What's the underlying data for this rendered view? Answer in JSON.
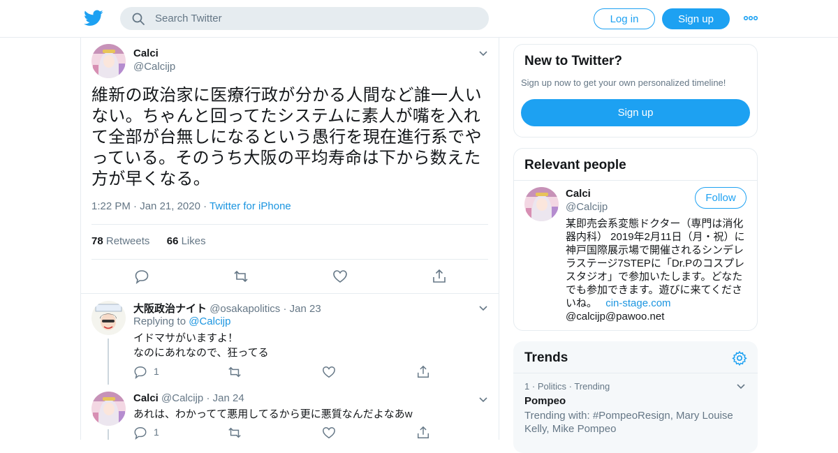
{
  "header": {
    "search_placeholder": "Search Twitter",
    "login_label": "Log in",
    "signup_label": "Sign up",
    "brand_color": "#1da1f2"
  },
  "tweet": {
    "author_name": "Calci",
    "author_handle": "@Calcijp",
    "text": "維新の政治家に医療行政が分かる人間など誰一人いない。ちゃんと回ってたシステムに素人が嘴を入れて全部が台無しになるという愚行を現在進行系でやっている。そのうち大阪の平均寿命は下から数えた方が早くなる。",
    "time": "1:22 PM",
    "date": "Jan 21, 2020",
    "source": "Twitter for iPhone",
    "retweets_count": "78",
    "retweets_label": "Retweets",
    "likes_count": "66",
    "likes_label": "Likes"
  },
  "replies": [
    {
      "name": "大阪政治ナイト",
      "handle": "@osakapolitics",
      "date": "Jan 23",
      "replying_prefix": "Replying to",
      "replying_to": "@Calcijp",
      "text": "イドマサがいますよ！\nなのにあれなので、狂ってる",
      "reply_count": "1"
    },
    {
      "name": "Calci",
      "handle": "@Calcijp",
      "date": "Jan 24",
      "text": "あれは、わかってて悪用してるから更に悪質なんだよなあw",
      "reply_count": "1"
    }
  ],
  "sidebar": {
    "new_title": "New to Twitter?",
    "new_subtitle": "Sign up now to get your own personalized timeline!",
    "new_signup_label": "Sign up",
    "relevant_title": "Relevant people",
    "person_name": "Calci",
    "person_handle": "@Calcijp",
    "follow_label": "Follow",
    "person_bio": "某即売会系変態ドクター（専門は消化器内科） 2019年2月11日（月・祝）に神戸国際展示場で開催されるシンデレラステージ7STEPに「Dr.Pのコスプレスタジオ」で参加いたします。どなたでも参加できます。遊びに来てくださいね。",
    "person_link": "cin-stage.com",
    "person_extra": "@calcijp@pawoo.net",
    "trends_title": "Trends",
    "trend_rank": "1",
    "trend_category": "Politics",
    "trend_status": "Trending",
    "trend_topic": "Pompeo",
    "trend_with": "Trending with: #PompeoResign, Mary Louise Kelly, Mike Pompeo"
  }
}
